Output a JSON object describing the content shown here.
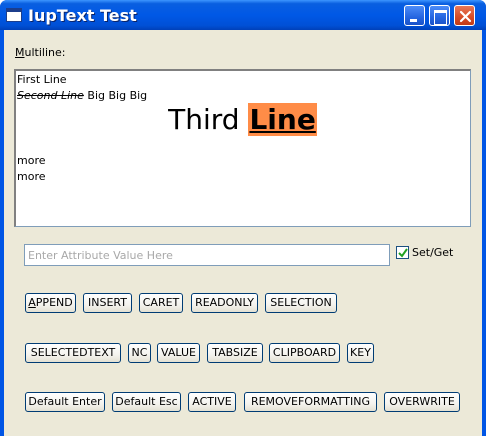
{
  "window": {
    "title": "IupText Test"
  },
  "multiline": {
    "label_accel": "M",
    "label_rest": "ultiline:",
    "lines": {
      "first": "First Line",
      "second_struck": "Second Line",
      "second_rest": " Big Big Big",
      "third_plain": "Third ",
      "third_highlight": "Line",
      "fourth": "more",
      "fifth": "more"
    },
    "highlight_color": "#ff8c47"
  },
  "attribute_input": {
    "placeholder": "Enter Attribute Value Here",
    "value": ""
  },
  "setget": {
    "label": "Set/Get",
    "checked": true
  },
  "buttons_row1": [
    {
      "accel": "A",
      "rest": "PPEND"
    },
    {
      "label": "INSERT"
    },
    {
      "label": "CARET"
    },
    {
      "label": "READONLY"
    },
    {
      "label": "SELECTION"
    }
  ],
  "buttons_row2": [
    {
      "label": "SELECTEDTEXT"
    },
    {
      "label": "NC"
    },
    {
      "label": "VALUE"
    },
    {
      "label": "TABSIZE"
    },
    {
      "label": "CLIPBOARD"
    },
    {
      "label": "KEY"
    }
  ],
  "buttons_row3": [
    {
      "label": "Default Enter"
    },
    {
      "label": "Default Esc"
    },
    {
      "label": "ACTIVE"
    },
    {
      "label": "REMOVEFORMATTING"
    },
    {
      "label": "OVERWRITE"
    }
  ],
  "colors": {
    "titlebar": "#0058e6",
    "client_background": "#ece9d8",
    "button_border": "#003c74"
  }
}
